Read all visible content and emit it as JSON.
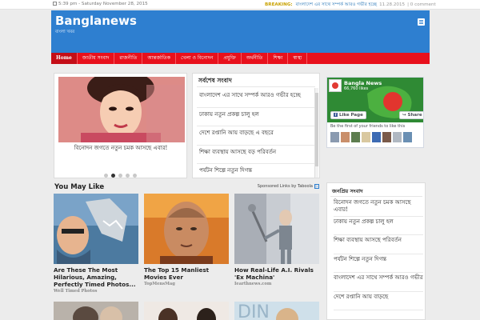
{
  "topbar": {
    "date": "5:39 pm - Saturday November 28, 2015",
    "breaking_label": "BREAKING:",
    "breaking_title": "বাংলাদেশ এর সাথে সম্পর্ক আরও গভীর হচ্ছে",
    "breaking_date": "11.28.2015",
    "breaking_comments": "0 comment"
  },
  "header": {
    "title": "Banglanews",
    "tagline": "বাংলা খবর"
  },
  "nav": {
    "items": [
      "Home",
      "জাতীয় সংবাদ",
      "রাজনীতি",
      "আন্তর্জাতিক",
      "খেলা ও বিনোদন",
      "প্রযুক্তি",
      "অর্থনীতি",
      "শিক্ষা",
      "স্বাস্থ্য"
    ]
  },
  "slider": {
    "caption": "বিনোদন জগতে নতুন চমক আসছে এবার!",
    "dots": 5,
    "active_dot": 2
  },
  "latest": {
    "heading": "সর্বশেষ সংবাদ",
    "items": [
      "বাংলাদেশ এর সাথে সম্পর্ক আরও গভীর হচ্ছে",
      "ঢাকায় নতুন প্রকল্প চালু হল",
      "দেশে রপ্তানি আয় বাড়ছে এ বছরে",
      "শিক্ষা ব্যবস্থায় আসছে বড় পরিবর্তন",
      "পর্যটন শিল্পে নতুন দিগন্ত"
    ]
  },
  "facebook": {
    "page_name": "Bangla News",
    "likes": "66,760 likes",
    "like_button": "Like Page",
    "share_button": "Share",
    "friends_text": "Be the first of your friends to like this"
  },
  "you_may_like": {
    "heading": "You May Like",
    "sponsor": "Sponsored Links by Taboola",
    "cards": [
      {
        "title": "Are These The Most Hilarious, Amazing, Perfectly Timed Photos...",
        "source": "Well Timed Photos"
      },
      {
        "title": "The Top 15 Manliest Movies Ever",
        "source": "TopMensMag"
      },
      {
        "title": "How Real-Life A.I. Rivals 'Ex Machina'",
        "source": "Iearthnews.com"
      }
    ]
  },
  "sidebar": {
    "heading": "জনপ্রিয় সংবাদ",
    "items": [
      "বিনোদন জগতে নতুন চমক আসছে এবার!",
      "ঢাকায় নতুন প্রকল্প চালু হল",
      "শিক্ষা ব্যবস্থায় আসছে পরিবর্তন",
      "পর্যটন শিল্পে নতুন দিগন্ত",
      "বাংলাদেশ এর সাথে সম্পর্ক আরও গভীর",
      "দেশে রপ্তানি আয় বাড়ছে"
    ]
  }
}
